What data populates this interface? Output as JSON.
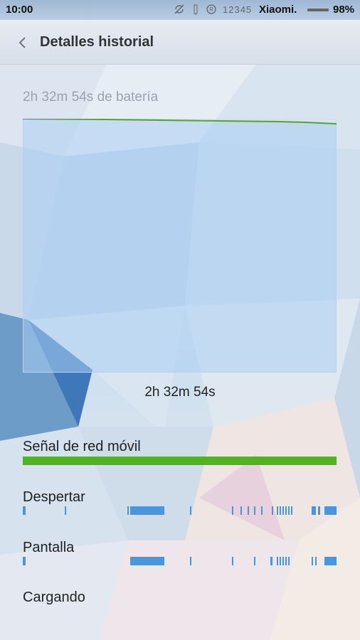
{
  "status_bar": {
    "time": "10:00",
    "carrier_digits": "12345",
    "carrier": "Xiaomi.",
    "battery": "98%"
  },
  "header": {
    "title": "Detalles historial"
  },
  "summary": {
    "battery_time": "2h 32m 54s de batería",
    "duration": "2h 32m 54s"
  },
  "chart_data": {
    "type": "area",
    "x": [
      0,
      0.2,
      0.4,
      0.6,
      0.8,
      0.9,
      1.0
    ],
    "y": [
      100,
      99.8,
      99.5,
      99.2,
      98.9,
      98.6,
      98
    ],
    "ylim": [
      0,
      100
    ],
    "xlabel": "2h 32m 54s",
    "grid": false,
    "colors": {
      "fill": "#a9cdf2",
      "line": "#4ea62a",
      "border": "#d0dbe6"
    }
  },
  "rows": {
    "signal": {
      "label": "Señal de red móvil",
      "coverage": 1.0,
      "color": "#52b322"
    },
    "wake": {
      "label": "Despertar",
      "color": "#4a96dd",
      "intervals": [
        [
          0,
          0.008
        ],
        [
          0.133,
          0.137
        ],
        [
          0.333,
          0.336
        ],
        [
          0.342,
          0.452
        ],
        [
          0.533,
          0.537
        ],
        [
          0.667,
          0.671
        ],
        [
          0.694,
          0.698
        ],
        [
          0.716,
          0.719
        ],
        [
          0.738,
          0.742
        ],
        [
          0.76,
          0.764
        ],
        [
          0.793,
          0.797
        ],
        [
          0.81,
          0.813
        ],
        [
          0.819,
          0.822
        ],
        [
          0.828,
          0.831
        ],
        [
          0.837,
          0.84
        ],
        [
          0.846,
          0.85
        ],
        [
          0.854,
          0.857
        ],
        [
          0.92,
          0.934
        ],
        [
          0.942,
          0.948
        ],
        [
          0.962,
          1.0
        ]
      ]
    },
    "screen": {
      "label": "Pantalla",
      "color": "#4a96dd",
      "intervals": [
        [
          0,
          0.008
        ],
        [
          0.342,
          0.452
        ],
        [
          0.533,
          0.537
        ],
        [
          0.667,
          0.671
        ],
        [
          0.738,
          0.742
        ],
        [
          0.79,
          0.797
        ],
        [
          0.81,
          0.813
        ],
        [
          0.819,
          0.822
        ],
        [
          0.828,
          0.831
        ],
        [
          0.837,
          0.84
        ],
        [
          0.846,
          0.85
        ],
        [
          0.92,
          0.924
        ],
        [
          0.931,
          0.934
        ],
        [
          0.962,
          1.0
        ]
      ]
    },
    "charging": {
      "label": "Cargando",
      "intervals": []
    }
  }
}
